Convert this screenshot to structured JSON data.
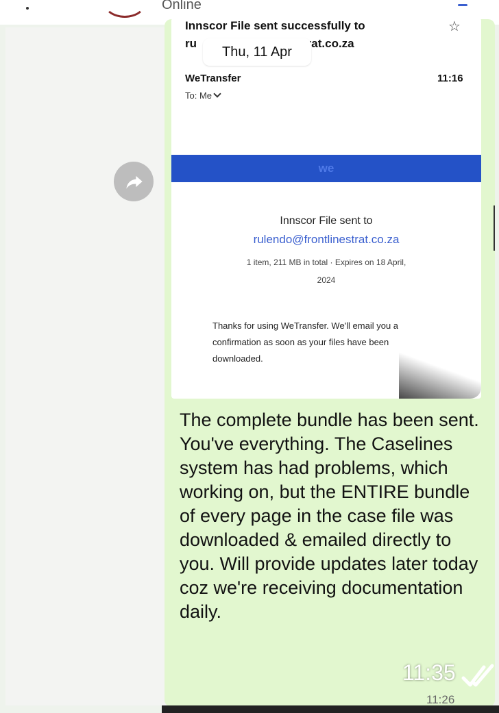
{
  "header": {
    "status": "Online"
  },
  "date_pill": "Thu, 11 Apr",
  "email": {
    "subject_line1": "Innscor File sent successfully to",
    "subject_line2_start": "ru",
    "subject_line2_end": "trat.co.za",
    "sender": "WeTransfer",
    "time": "11:16",
    "to": "To: Me",
    "banner": "we",
    "sent_to": "Innscor File sent to",
    "recipient": "rulendo@frontlinestrat.co.za",
    "meta_line1": "1 item, 211 MB in total  ·  Expires on 18 April,",
    "meta_line2": "2024",
    "thanks": "Thanks for using WeTransfer. We'll email you a confirmation as soon as your files have been downloaded."
  },
  "message": {
    "text": "The complete bundle has been sent. You've everything. The Caselines system has had problems, which working on, but the ENTIRE bundle of every page in the case file was downloaded & emailed directly to you. Will provide updates later today coz we're receiving documentation daily.",
    "timestamp_large": "11:35",
    "timestamp_small": "11:26"
  },
  "icons": {
    "forward": "forward-arrow-icon",
    "star": "star-outline-icon",
    "ticks": "double-check-icon",
    "chevron": "chevron-down-icon"
  }
}
